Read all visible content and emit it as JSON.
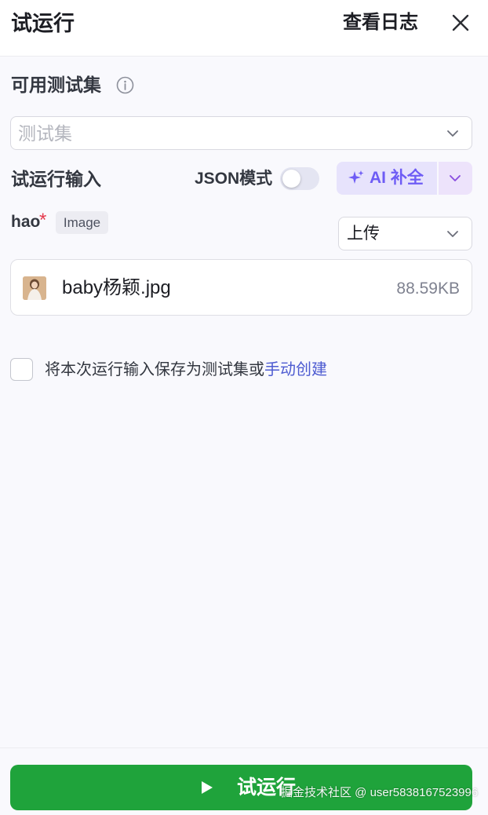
{
  "header": {
    "title": "试运行",
    "view_log": "查看日志"
  },
  "testset": {
    "label": "可用测试集",
    "placeholder": "测试集"
  },
  "run_input": {
    "label": "试运行输入",
    "json_mode_label": "JSON模式",
    "json_mode_on": false,
    "ai_complete_label": "AI 补全"
  },
  "field": {
    "name": "hao",
    "required_mark": "*",
    "type_tag": "Image",
    "upload_mode": "上传"
  },
  "file": {
    "name": "baby杨颖.jpg",
    "size": "88.59KB"
  },
  "save": {
    "text": "将本次运行输入保存为测试集或",
    "link": "手动创建",
    "checked": false
  },
  "run_button": {
    "label": "试运行"
  },
  "watermark": "掘金技术社区 @ user5838167523996",
  "colors": {
    "primary_green": "#1fa33b",
    "ai_purple": "#6e5cf5",
    "link_blue": "#4d5bd1",
    "required_red": "#e5394c"
  },
  "icons": {
    "close": "close-icon",
    "info": "info-icon",
    "chevron": "chevron-down-icon",
    "sparkle": "sparkle-icon",
    "play": "play-icon"
  }
}
